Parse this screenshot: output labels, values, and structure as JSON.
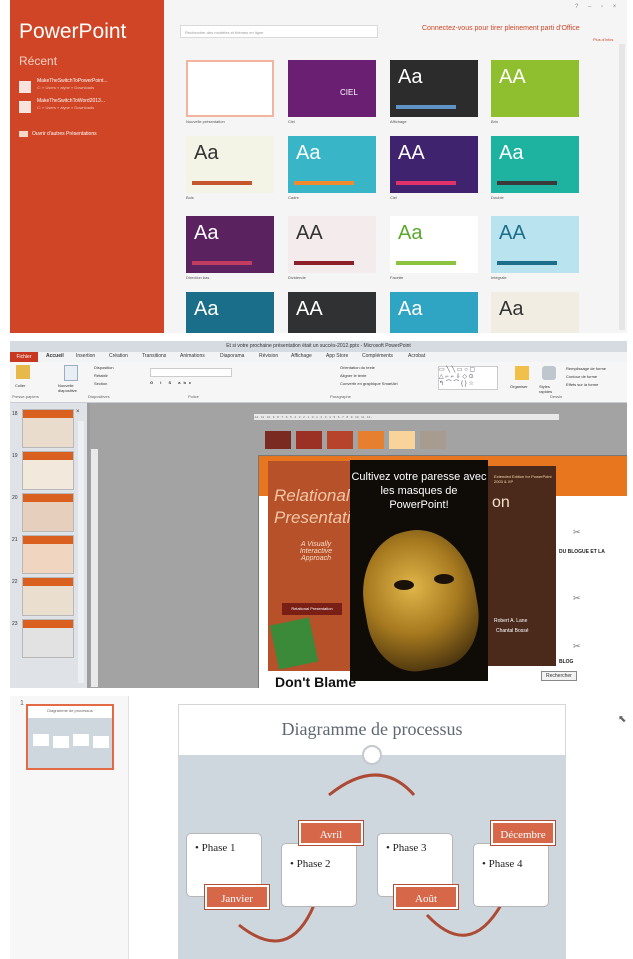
{
  "start_screen": {
    "app_title": "PowerPoint",
    "recent_label": "Récent",
    "recent_files": [
      {
        "name": "MakeTheSwitchToPowerPoint...",
        "path": "C: » Users » alyne » Downloads"
      },
      {
        "name": "MakeTheSwitchToWord2013...",
        "path": "C: » Users » alyne » Downloads"
      }
    ],
    "open_other": "Ouvrir d'autres Présentations",
    "search_placeholder": "Rechercher des modèles et thèmes en ligne",
    "connect_text": "Connectez-vous pour tirer pleinement parti d'Office",
    "switch_account": "Plus d'infos",
    "templates": [
      {
        "label": "Nouvelle présentation",
        "sample": "",
        "bg": "#ffffff",
        "fg": "#333333",
        "stripe": "#ffffff"
      },
      {
        "label": "Ciel",
        "sample": "CIEL",
        "bg": "#6a1f72",
        "fg": "#ffffff",
        "stripe": "#6a1f72"
      },
      {
        "label": "Affichage",
        "sample": "Aa",
        "bg": "#2c2c2c",
        "fg": "#ffffff",
        "stripe": "#5f93c6"
      },
      {
        "label": "Brin",
        "sample": "AA",
        "bg": "#8fbf2f",
        "fg": "#ffffff",
        "stripe": "#8fbf2f"
      },
      {
        "label": "Bois",
        "sample": "Aa",
        "bg": "#f3f3e6",
        "fg": "#333333",
        "stripe": "#c5562e"
      },
      {
        "label": "Cadre",
        "sample": "Aa",
        "bg": "#38b6c8",
        "fg": "#ffffff",
        "stripe": "#ef8a2e"
      },
      {
        "label": "Ciel",
        "sample": "AA",
        "bg": "#3f236e",
        "fg": "#ffffff",
        "stripe": "#e0316a"
      },
      {
        "label": "Double",
        "sample": "Aa",
        "bg": "#1eb3a0",
        "fg": "#ffffff",
        "stripe": "#3a3a3a"
      },
      {
        "label": "Direction bas",
        "sample": "Aa",
        "bg": "#5a2360",
        "fg": "#ffffff",
        "stripe": "#c23b61"
      },
      {
        "label": "Dividende",
        "sample": "AA",
        "bg": "#f4ecec",
        "fg": "#333333",
        "stripe": "#8d1f2a"
      },
      {
        "label": "Facette",
        "sample": "Aa",
        "bg": "#ffffff",
        "fg": "#5aa82e",
        "stripe": "#8cc43f"
      },
      {
        "label": "Intégrale",
        "sample": "AA",
        "bg": "#b8e3ef",
        "fg": "#1d6e88",
        "stripe": "#1d6e88"
      },
      {
        "label": "",
        "sample": "Aa",
        "bg": "#1b6e8a",
        "fg": "#ffffff",
        "stripe": "#1b6e8a"
      },
      {
        "label": "",
        "sample": "AA",
        "bg": "#2f3133",
        "fg": "#ffffff",
        "stripe": "#2f3133"
      },
      {
        "label": "",
        "sample": "Aa",
        "bg": "#2fa4c3",
        "fg": "#ffffff",
        "stripe": "#2fa4c3"
      },
      {
        "label": "",
        "sample": "Aa",
        "bg": "#f2ede3",
        "fg": "#333333",
        "stripe": "#a56c3a"
      }
    ]
  },
  "editor": {
    "window_title": "Et si votre prochaine présentation était un succès-2012.pptx - Microsoft PowerPoint",
    "tabs": [
      "Fichier",
      "Accueil",
      "Insertion",
      "Création",
      "Transitions",
      "Animations",
      "Diaporama",
      "Révision",
      "Affichage",
      "App Store",
      "Compléments",
      "Acrobat"
    ],
    "ribbon": {
      "paste": "Coller",
      "new_slide": "Nouvelle diapositive",
      "layout": "Disposition",
      "reset": "Rétablir",
      "section": "Section",
      "text_direction": "Orientation du texte",
      "align_text": "Aligner le texte",
      "smartart": "Convertir en graphique SmartArt",
      "arrange": "Organiser",
      "quick_styles": "Styles rapides",
      "shape_fill": "Remplissage de forme",
      "shape_outline": "Contour de forme",
      "shape_effects": "Effets sur la forme",
      "groups": [
        "Presse-papiers",
        "Diapositives",
        "Police",
        "Paragraphe",
        "Dessin"
      ]
    },
    "slide_numbers": [
      "18",
      "19",
      "20",
      "21",
      "22",
      "23"
    ],
    "ruler": "-12 · 11 · 10 · 9 · 8 · 7 · 6 · 5 · 4 · 3 · 2 · 1 · 0 · 1 · 2 · 3 · 4 · 5 · 6 · 7 · 8 · 9 · 10 · 11 · 12 -",
    "swatches": [
      "#7b2a22",
      "#9b3125",
      "#b8432b",
      "#e6802e",
      "#f8d49a",
      "#a79c8f"
    ],
    "slide": {
      "mask_caption": "Cultivez votre paresse avec les masques de PowerPoint!",
      "book_left": "Relational Presentation",
      "book_left_sub": "A Visually Interactive Approach",
      "book_left_badge": "Relational Presentation",
      "book_right_tag": "Extended Edition for PowerPoint 2003 & XP",
      "book_right_title": "on",
      "authors": "Robert A. Lane",
      "author2": "Chantal Bossé",
      "blog": "DU BLOGUE ET LA",
      "blog2": "BLOG",
      "search_btn": "Rechercher",
      "bottom_text": "Don't Blame"
    }
  },
  "diagram": {
    "slide_number": "1",
    "thumb_title": "Diagramme de processus",
    "title": "Diagramme de processus",
    "phases": [
      "Phase 1",
      "Phase 2",
      "Phase 3",
      "Phase 4"
    ],
    "months": [
      "Janvier",
      "Avril",
      "Août",
      "Décembre"
    ],
    "accent": "#d66749"
  }
}
